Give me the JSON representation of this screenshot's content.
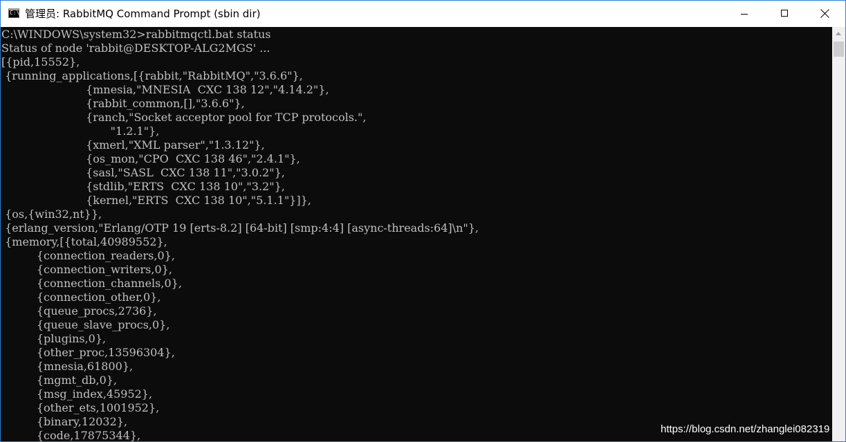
{
  "window": {
    "title": "管理员: RabbitMQ Command Prompt (sbin dir)",
    "app_icon_glyph": "C:\\",
    "controls": {
      "minimize": "minimize",
      "maximize": "maximize",
      "close": "close"
    }
  },
  "colors": {
    "console_background": "#0c0c0c",
    "console_text": "#c0c0c0",
    "window_border": "#2b7bd6",
    "scrollbar_track": "#f0f0f0",
    "scrollbar_thumb": "#cdcdcd"
  },
  "console": {
    "lines": [
      "C:\\WINDOWS\\system32>rabbitmqctl.bat status",
      "Status of node 'rabbit@DESKTOP-ALG2MGS' ...",
      "[{pid,15552},",
      " {running_applications,[{rabbit,\"RabbitMQ\",\"3.6.6\"},",
      "                        {mnesia,\"MNESIA  CXC 138 12\",\"4.14.2\"},",
      "                        {rabbit_common,[],\"3.6.6\"},",
      "                        {ranch,\"Socket acceptor pool for TCP protocols.\",",
      "                               \"1.2.1\"},",
      "                        {xmerl,\"XML parser\",\"1.3.12\"},",
      "                        {os_mon,\"CPO  CXC 138 46\",\"2.4.1\"},",
      "                        {sasl,\"SASL  CXC 138 11\",\"3.0.2\"},",
      "                        {stdlib,\"ERTS  CXC 138 10\",\"3.2\"},",
      "                        {kernel,\"ERTS  CXC 138 10\",\"5.1.1\"}]},",
      " {os,{win32,nt}},",
      " {erlang_version,\"Erlang/OTP 19 [erts-8.2] [64-bit] [smp:4:4] [async-threads:64]\\n\"},",
      " {memory,[{total,40989552},",
      "          {connection_readers,0},",
      "          {connection_writers,0},",
      "          {connection_channels,0},",
      "          {connection_other,0},",
      "          {queue_procs,2736},",
      "          {queue_slave_procs,0},",
      "          {plugins,0},",
      "          {other_proc,13596304},",
      "          {mnesia,61800},",
      "          {mgmt_db,0},",
      "          {msg_index,45952},",
      "          {other_ets,1001952},",
      "          {binary,12032},",
      "          {code,17875344},"
    ]
  },
  "watermark": "https://blog.csdn.net/zhanglei082319"
}
